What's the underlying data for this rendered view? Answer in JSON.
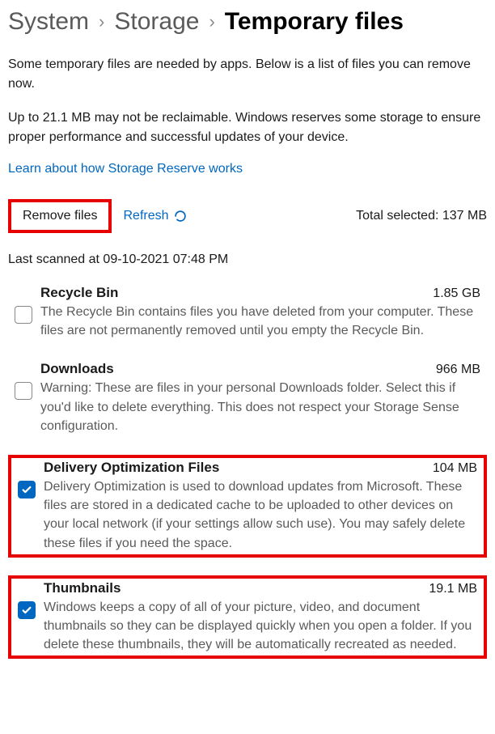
{
  "breadcrumb": {
    "system": "System",
    "storage": "Storage",
    "current": "Temporary files"
  },
  "intro": {
    "p1": "Some temporary files are needed by apps. Below is a list of files you can remove now.",
    "p2": "Up to 21.1 MB may not be reclaimable. Windows reserves some storage to ensure proper performance and successful updates of your device."
  },
  "learnLink": "Learn about how Storage Reserve works",
  "actions": {
    "remove": "Remove files",
    "refresh": "Refresh",
    "totalSelectedLabel": "Total selected:",
    "totalSelectedValue": "137 MB"
  },
  "lastScanned": "Last scanned at 09-10-2021 07:48 PM",
  "items": [
    {
      "title": "Recycle Bin",
      "size": "1.85 GB",
      "desc": "The Recycle Bin contains files you have deleted from your computer. These files are not permanently removed until you empty the Recycle Bin.",
      "checked": false,
      "highlighted": false
    },
    {
      "title": "Downloads",
      "size": "966 MB",
      "desc": "Warning: These are files in your personal Downloads folder. Select this if you'd like to delete everything. This does not respect your Storage Sense configuration.",
      "checked": false,
      "highlighted": false
    },
    {
      "title": "Delivery Optimization Files",
      "size": "104 MB",
      "desc": "Delivery Optimization is used to download updates from Microsoft. These files are stored in a dedicated cache to be uploaded to other devices on your local network (if your settings allow such use). You may safely delete these files if you need the space.",
      "checked": true,
      "highlighted": true
    },
    {
      "title": "Thumbnails",
      "size": "19.1 MB",
      "desc": "Windows keeps a copy of all of your picture, video, and document thumbnails so they can be displayed quickly when you open a folder. If you delete these thumbnails, they will be automatically recreated as needed.",
      "checked": true,
      "highlighted": true
    }
  ]
}
